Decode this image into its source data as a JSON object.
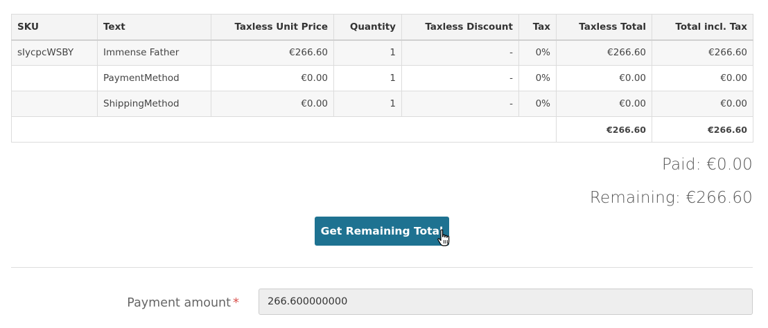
{
  "table": {
    "headers": [
      "SKU",
      "Text",
      "Taxless Unit Price",
      "Quantity",
      "Taxless Discount",
      "Tax",
      "Taxless Total",
      "Total incl. Tax"
    ],
    "rows": [
      [
        "sIycpcWSBY",
        "Immense Father",
        "€266.60",
        "1",
        "-",
        "0%",
        "€266.60",
        "€266.60"
      ],
      [
        "",
        "PaymentMethod",
        "€0.00",
        "1",
        "-",
        "0%",
        "€0.00",
        "€0.00"
      ],
      [
        "",
        "ShippingMethod",
        "€0.00",
        "1",
        "-",
        "0%",
        "€0.00",
        "€0.00"
      ]
    ],
    "totals": {
      "taxless_total": "€266.60",
      "total_incl_tax": "€266.60"
    }
  },
  "summary": {
    "paid": "Paid: €0.00",
    "remaining": "Remaining: €266.60"
  },
  "actions": {
    "get_remaining_total": "Get Remaining Total"
  },
  "form": {
    "payment_amount_label": "Payment amount",
    "required_marker": "*",
    "payment_amount_value": "266.600000000"
  },
  "colors": {
    "button": "#1e7291",
    "required": "#d9534f"
  },
  "icons": {
    "cursor": "hand-pointer-icon"
  }
}
